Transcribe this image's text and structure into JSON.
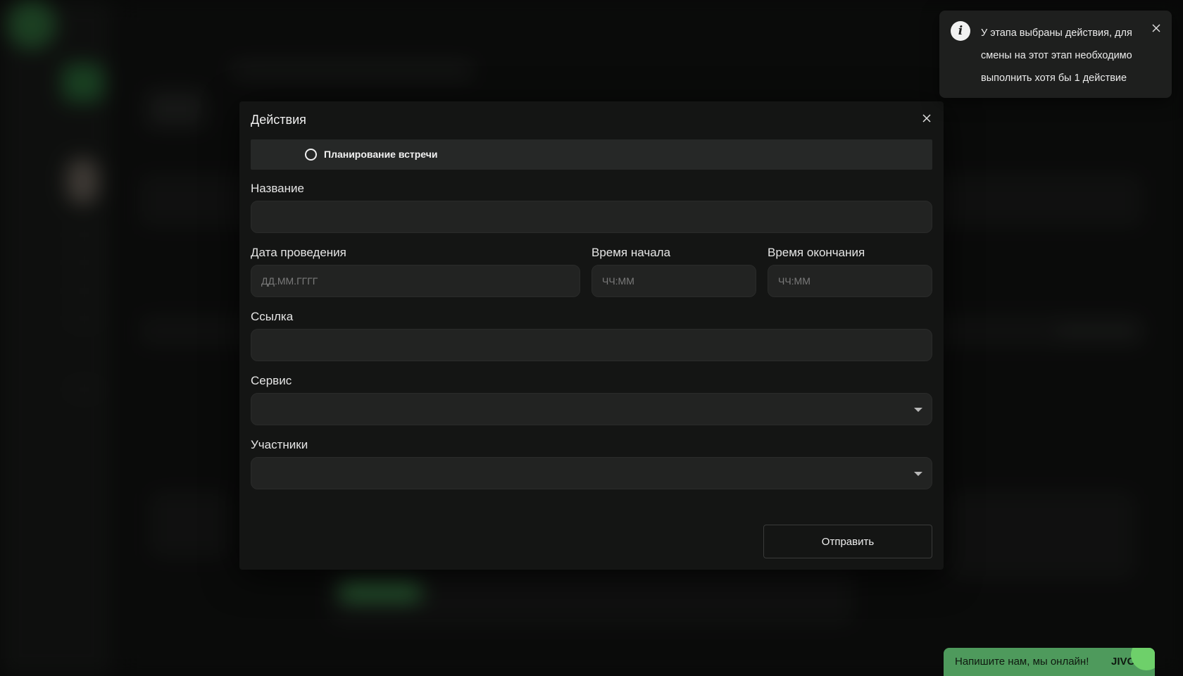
{
  "modal": {
    "title": "Действия",
    "action_label": "Планирование встречи",
    "fields": {
      "name_label": "Название",
      "name_value": "",
      "date_label": "Дата проведения",
      "date_placeholder": "ДД.ММ.ГГГГ",
      "start_label": "Время начала",
      "start_placeholder": "ЧЧ:ММ",
      "end_label": "Время окончания",
      "end_placeholder": "ЧЧ:ММ",
      "link_label": "Ссылка",
      "link_value": "",
      "service_label": "Сервис",
      "service_value": "",
      "participants_label": "Участники",
      "participants_value": ""
    },
    "submit_label": "Отправить"
  },
  "toast": {
    "message": "У этапа выбраны действия, для смены на этот этап необходимо выполнить хотя бы 1 действие",
    "icon": "info-icon"
  },
  "chat_widget": {
    "text": "Напишите нам, мы онлайн!",
    "logo": "JIVO",
    "color": "#4e9a5c"
  },
  "colors": {
    "modal_bg": "#141514",
    "input_bg": "#222322",
    "accent_green": "#4e9a5c"
  }
}
